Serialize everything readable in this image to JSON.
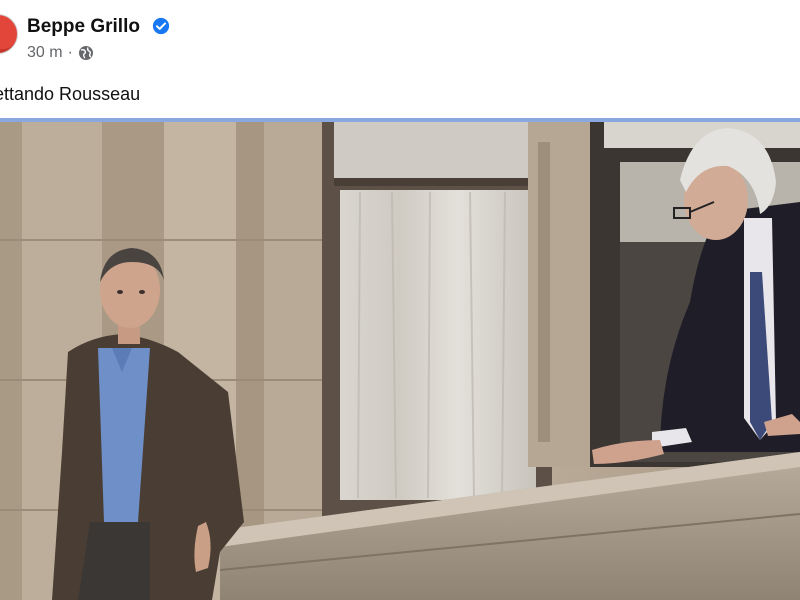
{
  "post": {
    "author": "Beppe Grillo",
    "time": "30 m",
    "separator": "·",
    "text": "ettando Rousseau",
    "verified_icon": "verified-badge-icon",
    "audience_icon": "globe-icon"
  },
  "colors": {
    "verified": "#1877f2",
    "divider": "#8aa8e0",
    "meta_text": "#65676b"
  }
}
